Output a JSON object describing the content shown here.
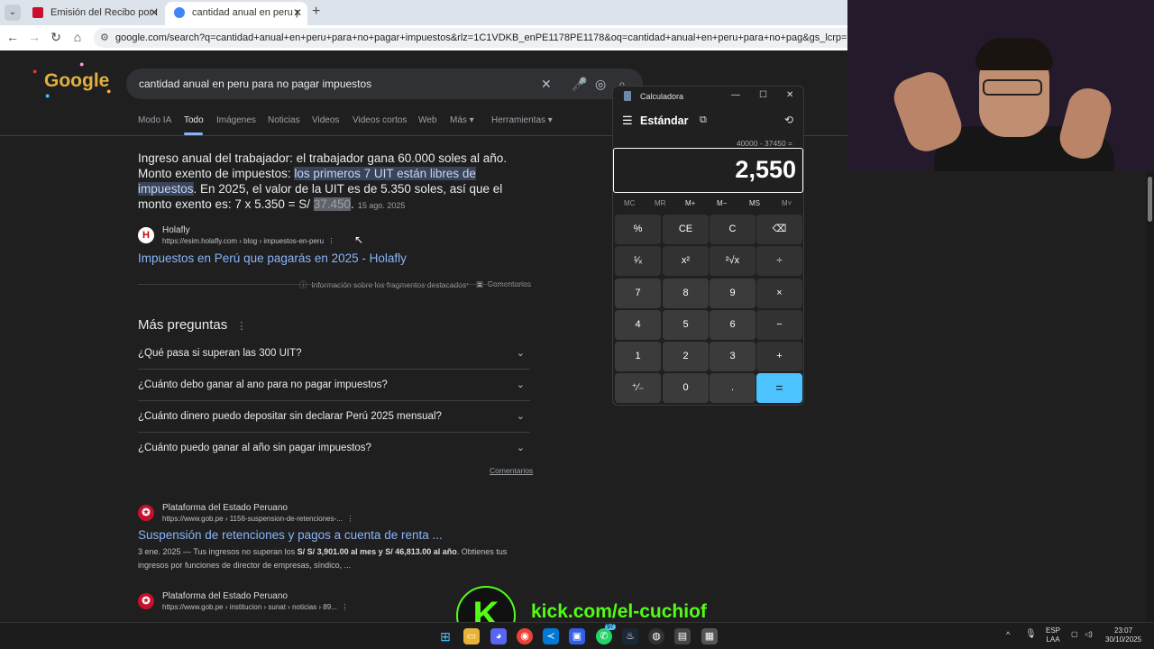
{
  "browser": {
    "tabs": [
      {
        "label": "Emisión del Recibo por Honorarios",
        "active": false
      },
      {
        "label": "cantidad anual en peru para no pagar impuestos",
        "active": true
      }
    ],
    "url": "google.com/search?q=cantidad+anual+en+peru+para+no+pagar+impuestos&rlz=1C1VDKB_enPE1178PE1178&oq=cantidad+anual+en+peru+para+no+pag&gs_lcrp=EgZjaHJvbWUqBwgBECEYoA"
  },
  "google": {
    "query": "cantidad anual en peru para no pagar impuestos",
    "tabs": [
      "Modo IA",
      "Todo",
      "Imágenes",
      "Noticias",
      "Videos",
      "Videos cortos",
      "Web",
      "Más ▾",
      "Herramientas ▾"
    ],
    "featured": {
      "part1": "Ingreso anual del trabajador: el trabajador gana 60.000 soles al año. Monto exento de impuestos: ",
      "highlight": "los primeros 7 UIT están libres de impuestos",
      "part2": ". En 2025, el valor de la UIT es de 5.350 soles, así que el monto exento es: 7 x 5.350 = S/ ",
      "amount": "37.450",
      "part3": ".",
      "date": "15 ago. 2025",
      "source_name": "Holafly",
      "source_url": "https://esim.holafly.com › blog › impuestos-en-peru",
      "title": "Impuestos en Perú que pagarás en 2025 - Holafly",
      "info": "Información sobre los fragmentos destacados",
      "feedback": "Comentarios"
    },
    "more_questions": {
      "title": "Más preguntas",
      "items": [
        "¿Qué pasa si superan las 300 UIT?",
        "¿Cuánto debo ganar al ano para no pagar impuestos?",
        "¿Cuánto dinero puedo depositar sin declarar Perú 2025 mensual?",
        "¿Cuánto puedo ganar al año sin pagar impuestos?"
      ],
      "feedback": "Comentarios"
    },
    "results": [
      {
        "source_name": "Plataforma del Estado Peruano",
        "source_url": "https://www.gob.pe › 1156-suspension-de-retenciones-...",
        "title": "Suspensión de retenciones y pagos a cuenta de renta ...",
        "snippet_date": "3 ene. 2025",
        "snippet_a": " — Tus ingresos no superan los ",
        "snippet_b": "S/ S/ 3,901.00 al mes y S/ 46,813.00 al año",
        "snippet_c": ". Obtienes tus ingresos por funciones de director de empresas, síndico, ..."
      },
      {
        "source_name": "Plataforma del Estado Peruano",
        "source_url": "https://www.gob.pe › institucion › sunat › noticias › 89..."
      }
    ]
  },
  "calculator": {
    "title": "Calculadora",
    "mode": "Estándar",
    "expression": "40000 - 37450 =",
    "display": "2,550",
    "memory": [
      "MC",
      "MR",
      "M+",
      "M−",
      "MS",
      "M˅"
    ],
    "keys": [
      "%",
      "CE",
      "C",
      "⌫",
      "¹⁄ₓ",
      "x²",
      "²√x",
      "÷",
      "7",
      "8",
      "9",
      "×",
      "4",
      "5",
      "6",
      "−",
      "1",
      "2",
      "3",
      "+",
      "⁺∕₋",
      "0",
      ".",
      "="
    ]
  },
  "overlay": {
    "kick_letter": "K",
    "kick_url": "kick.com/el-cuchiof"
  },
  "taskbar": {
    "lang": "ESP",
    "lang2": "LAA",
    "time": "23:07",
    "date": "30/10/2025",
    "badge": "97"
  }
}
